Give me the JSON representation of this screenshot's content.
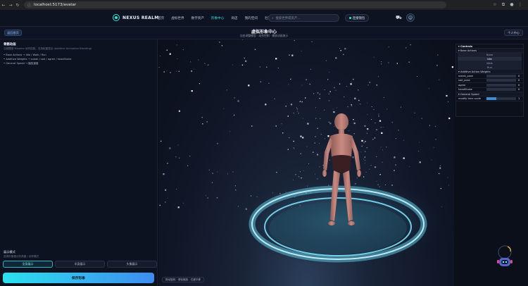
{
  "browser": {
    "url": "localhost:5173/avatar"
  },
  "header": {
    "brand": "NEXUS REALM",
    "nav": [
      "首页",
      "虚拟世界",
      "数字资产",
      "形象中心",
      "商店",
      "我的空间",
      "社区"
    ],
    "active_nav": "形象中心",
    "search_placeholder": "搜索世界或资产...",
    "connect_label": "连接钱包"
  },
  "subheader": {
    "back_label": "返回首页",
    "title": "虚拟形象中心",
    "subtitle": "自由调整模型 · 动作控制 · 播放动画演示",
    "personal_label": "个人中心"
  },
  "left_panel": {
    "title": "骨骼动画",
    "desc": "当前模型 Mixamo 动作控制，支持权重混合 (Additive Animation Blending)",
    "items": [
      "Base Actions → Idle / Walk / Run",
      "Additive Weights → sneak / sad / agree / headShake",
      "General Speed → 播放速度"
    ],
    "mode_label": "展示模式",
    "mode_desc": "选择形象展示的角度 / 动作模式",
    "modes": [
      "全身展示",
      "半身展示",
      "头像展示"
    ],
    "active_mode": 0,
    "save_label": "保存形象"
  },
  "viewport": {
    "hint": "拖动旋转 · 滚轮缩放 · 右键平移"
  },
  "controls": {
    "title": "Controls",
    "base_actions_title": "Base Actions",
    "base_actions": [
      "None",
      "Idle",
      "Walk",
      "Run"
    ],
    "selected_base": 1,
    "additive_title": "Additive Action Weights",
    "additive": [
      {
        "name": "sneak_pose",
        "value": "0"
      },
      {
        "name": "sad_pose",
        "value": "0"
      },
      {
        "name": "agree",
        "value": "0"
      },
      {
        "name": "headShake",
        "value": "0"
      }
    ],
    "speed_title": "General Speed",
    "speed_label": "modify time scale",
    "speed_value": "1"
  },
  "colors": {
    "accent": "#2ee6d6",
    "ring": "#7fe9ff",
    "figure": "#c98a80"
  }
}
